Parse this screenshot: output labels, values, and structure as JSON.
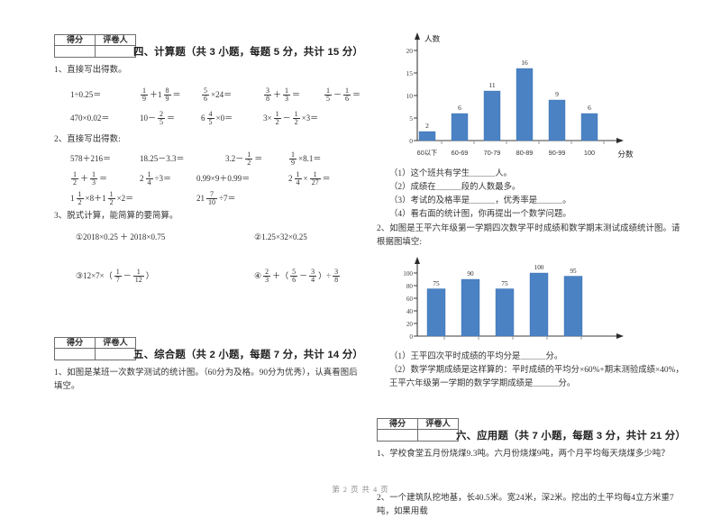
{
  "document": {
    "footer": "第 2 页 共 4 页",
    "score_box": {
      "score_label": "得分",
      "grader_label": "评卷人"
    }
  },
  "section_four": {
    "heading": "四、计算题（共 3 小题，每题 5 分，共计 15 分）",
    "q1": {
      "prompt": "1、直接写出得数。",
      "row1": [
        {
          "type": "plain",
          "text": "1÷0.25＝"
        },
        {
          "type": "frac_sum",
          "a": "1",
          "b": "9",
          "mix": "1",
          "c": "8",
          "d": "9",
          "op": "＋",
          "tail": "＝"
        },
        {
          "type": "frac_mul",
          "a": "5",
          "b": "6",
          "op": "×",
          "n": "24",
          "tail": "＝"
        },
        {
          "type": "frac_sum2",
          "a": "3",
          "b": "8",
          "op": "＋",
          "c": "1",
          "d": "3",
          "tail": "＝"
        },
        {
          "type": "frac_sum2",
          "a": "1",
          "b": "5",
          "op": "－",
          "c": "1",
          "d": "6",
          "tail": "＝"
        }
      ],
      "row2": [
        {
          "type": "plain",
          "text": "470×0.02＝"
        },
        {
          "type": "int_frac",
          "n": "10",
          "op": "－",
          "a": "2",
          "b": "5",
          "tail": "＝"
        },
        {
          "type": "mixed_mul",
          "w": "6",
          "a": "4",
          "b": "5",
          "op": "×",
          "n": "0",
          "tail": "＝"
        },
        {
          "type": "three",
          "text": "3×",
          "a": "1",
          "b": "2",
          "op": "－",
          "c": "1",
          "d": "2",
          "tail": "×3＝"
        }
      ]
    },
    "q2": {
      "prompt": "2、直接写出得数:",
      "row1": [
        {
          "type": "plain",
          "text": "578＋216＝"
        },
        {
          "type": "plain",
          "text": "18.25－3.3＝"
        },
        {
          "type": "int_frac",
          "n": "3.2",
          "op": "－",
          "a": "1",
          "b": "2",
          "tail": "＝"
        },
        {
          "type": "frac_mul",
          "a": "1",
          "b": "9",
          "op": "×",
          "n": "8.1",
          "tail": "＝"
        }
      ],
      "row2": [
        {
          "type": "frac_sum2",
          "a": "1",
          "b": "2",
          "op": "＋",
          "c": "1",
          "d": "3",
          "tail": "＝"
        },
        {
          "type": "mixed_div",
          "w": "2",
          "a": "1",
          "b": "4",
          "op": "÷",
          "n": "3",
          "tail": "＝"
        },
        {
          "type": "plain",
          "text": "0.99×9＋0.99＝"
        },
        {
          "type": "mixed_frac_mul",
          "w": "2",
          "a": "1",
          "b": "4",
          "op": "×",
          "c": "1",
          "d": "27",
          "tail": "＝"
        }
      ],
      "row3": [
        {
          "type": "two_mixed",
          "w1": "1",
          "a": "1",
          "b": "2",
          "op1": "×8＋",
          "w2": "1",
          "c": "1",
          "d": "2",
          "op2": "×2＝"
        },
        {
          "type": "mixed_div",
          "w": "21",
          "a": "7",
          "b": "10",
          "op": "÷",
          "n": "7",
          "tail": "＝"
        }
      ]
    },
    "q3": {
      "prompt": "3、脱式计算，能简算的要简算。",
      "items": [
        {
          "label": "①",
          "type": "plain",
          "text": "2018×0.25 ＋ 2018×0.75"
        },
        {
          "label": "②",
          "type": "plain",
          "text": "1.25×32×0.25"
        },
        {
          "label": "③",
          "type": "paren_frac",
          "lead": "12×7×（",
          "a": "1",
          "b": "7",
          "op": "－",
          "c": "1",
          "d": "12",
          "tail": "）"
        },
        {
          "label": "④",
          "type": "frac_expr",
          "a": "2",
          "b": "3",
          "lead": "＋（",
          "c": "5",
          "d": "6",
          "op": "－",
          "e": "3",
          "f": "4",
          "mid": "）÷",
          "g": "3",
          "h": "8"
        }
      ]
    }
  },
  "section_five": {
    "heading": "五、综合题（共 2 小题，每题 7 分，共计 14 分）",
    "q1_prompt": "1、如图是某班一次数学测试的统计图。（60分为及格。90分为优秀），认真看图后填空。",
    "q1_subs": [
      "（1）这个班共有学生＿＿＿人。",
      "（2）成绩在＿＿＿段的人数最多。",
      "（3）考试的及格率是＿＿＿，优秀率是＿＿＿。",
      "（4）看右面的统计图，你再提出一个数学问题。"
    ],
    "q2_prompt": "2、如图是王平六年级第一学期四次数学平时成绩和数学期末测试成绩统计图。请根据图填空:",
    "q2_subs": [
      "（1）王平四次平时成绩的平均分是＿＿＿分。",
      "（2）数学学期成绩是这样算的：平时成绩的平均分×60%+期末测验成绩×40%，王平六年级第一学期的数学学期成绩是＿＿＿分。"
    ]
  },
  "section_six": {
    "heading": "六、应用题（共 7 小题，每题 3 分，共计 21 分）",
    "items": [
      "1、学校食堂五月份烧煤9.3吨。六月份烧煤9吨，两个月平均每天烧煤多少吨？",
      "2、一个建筑队挖地基，长40.5米。宽24米，深2米。挖出的土平均每4立方米重7吨，如果用载"
    ]
  },
  "chart_data": [
    {
      "type": "bar",
      "id": "score-distribution-chart",
      "title": "",
      "ylabel": "人数",
      "xlabel": "分数",
      "categories": [
        "60以下",
        "60-69",
        "70-79",
        "80-89",
        "90-99",
        "100"
      ],
      "values": [
        2,
        6,
        11,
        16,
        9,
        6
      ],
      "yticks": [
        0,
        5,
        10,
        15,
        20
      ],
      "ylim": [
        0,
        22
      ],
      "bar_color": "#4A82C4",
      "grid": false,
      "legend": "none",
      "data_labels": true
    },
    {
      "type": "bar",
      "id": "wangping-scores-chart",
      "title": "",
      "ylabel": "",
      "xlabel": "",
      "categories": [
        "",
        "",
        "",
        "",
        ""
      ],
      "values": [
        75,
        90,
        75,
        100,
        95
      ],
      "yticks": [
        0,
        20,
        40,
        60,
        80,
        100
      ],
      "ylim": [
        0,
        112
      ],
      "bar_color": "#4A82C4",
      "grid": false,
      "legend": "none",
      "data_labels": true
    }
  ]
}
